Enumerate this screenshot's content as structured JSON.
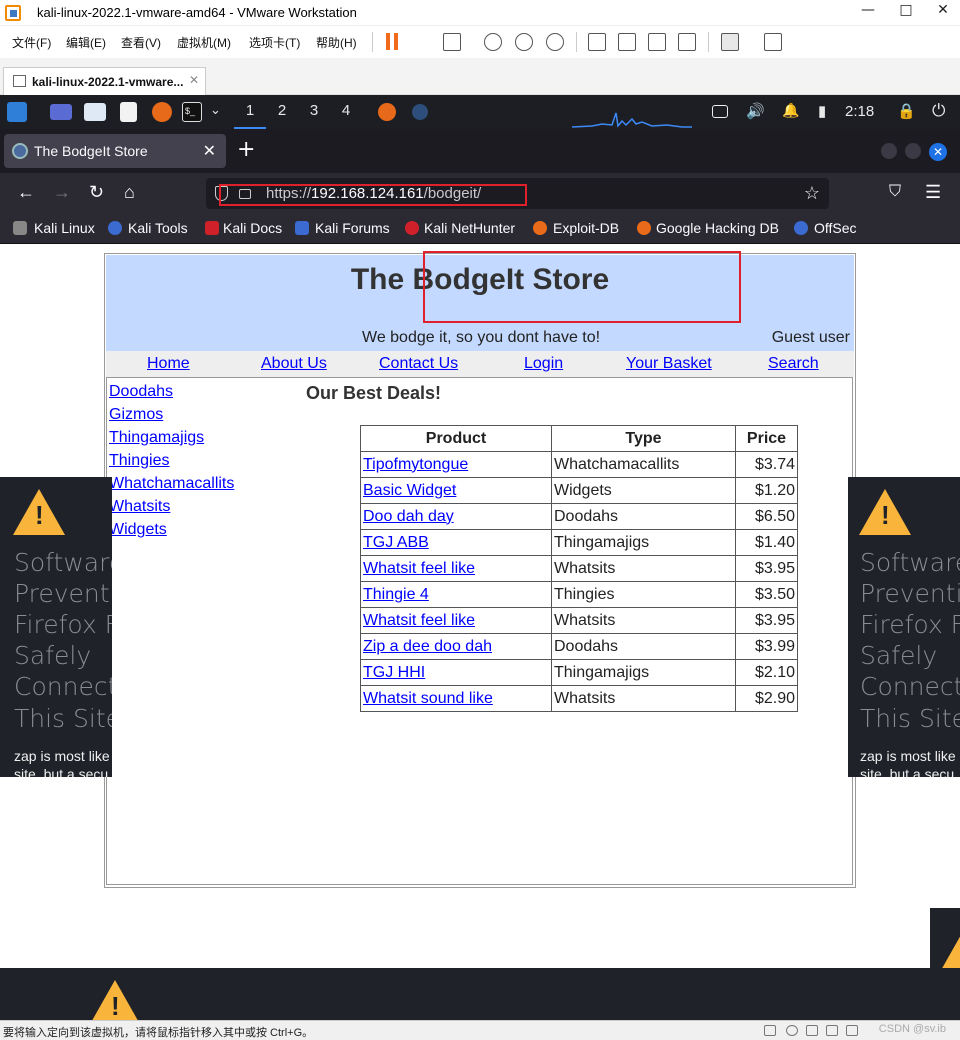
{
  "vmware": {
    "window_title": "kali-linux-2022.1-vmware-amd64 - VMware Workstation",
    "window_controls": {
      "minimize": "—",
      "maximize": "□",
      "close": "✕"
    },
    "menu": [
      "文件(F)",
      "编辑(E)",
      "查看(V)",
      "虚拟机(M)",
      "选项卡(T)",
      "帮助(H)"
    ],
    "tab_label": "kali-linux-2022.1-vmware...",
    "status_text": "要将输入定向到该虚拟机，请将鼠标指针移入其中或按 Ctrl+G。",
    "watermark": "CSDN @sv.ib"
  },
  "kali_panel": {
    "workspaces": [
      "1",
      "2",
      "3",
      "4"
    ],
    "active_workspace": "1",
    "clock": "2:18",
    "toolbar_glyphs": {
      "terminal": "$_",
      "dropdown": "⌄",
      "volume": "🔊",
      "bell": "🔔",
      "battery": "▮",
      "lock": "🔒",
      "power": "⏻"
    }
  },
  "firefox": {
    "tab_title": "The BodgeIt Store",
    "tab_close": "✕",
    "new_tab": "+",
    "close_glyph": "✕",
    "nav_glyphs": {
      "back": "←",
      "forward": "→",
      "reload": "↻",
      "home": "⌂",
      "bookmark": "☆",
      "pocket": "⛉",
      "menu": "☰"
    },
    "url_scheme": "https://",
    "url_host": "192.168.124.161",
    "url_path": "/bodgeit/",
    "bookmarks": [
      "Kali Linux",
      "Kali Tools",
      "Kali Docs",
      "Kali Forums",
      "Kali NetHunter",
      "Exploit-DB",
      "Google Hacking DB",
      "OffSec"
    ]
  },
  "store": {
    "title": "The BodgeIt Store",
    "tagline": "We bodge it, so you dont have to!",
    "user": "Guest user",
    "nav": [
      "Home",
      "About Us",
      "Contact Us",
      "Login",
      "Your Basket",
      "Search"
    ],
    "categories": [
      "Doodahs",
      "Gizmos",
      "Thingamajigs",
      "Thingies",
      "Whatchamacallits",
      "Whatsits",
      "Widgets"
    ],
    "deals_title": "Our Best Deals!",
    "table_headers": [
      "Product",
      "Type",
      "Price"
    ],
    "products": [
      {
        "product": "Tipofmytongue",
        "type": "Whatchamacallits",
        "price": "$3.74"
      },
      {
        "product": "Basic Widget",
        "type": "Widgets",
        "price": "$1.20"
      },
      {
        "product": "Doo dah day",
        "type": "Doodahs",
        "price": "$6.50"
      },
      {
        "product": "TGJ ABB",
        "type": "Thingamajigs",
        "price": "$1.40"
      },
      {
        "product": "Whatsit feel like",
        "type": "Whatsits",
        "price": "$3.95"
      },
      {
        "product": "Thingie 4",
        "type": "Thingies",
        "price": "$3.50"
      },
      {
        "product": "Whatsit feel like",
        "type": "Whatsits",
        "price": "$3.95"
      },
      {
        "product": "Zip a dee doo dah",
        "type": "Doodahs",
        "price": "$3.99"
      },
      {
        "product": "TGJ HHI",
        "type": "Thingamajigs",
        "price": "$2.10"
      },
      {
        "product": "Whatsit sound like",
        "type": "Whatsits",
        "price": "$2.90"
      }
    ]
  },
  "zap_overlay": {
    "warning_glyph": "!",
    "big_lines": [
      "Software",
      "Preventin",
      "Firefox F",
      "Safely",
      "Connecti",
      "This Site"
    ],
    "small_lines": [
      "zap is most like",
      "site, but a secu"
    ]
  },
  "colors": {
    "store_header_bg": "#c3d9ff",
    "link": "#0000ff",
    "highlight_box": "#e0202a",
    "warning": "#f9b43b",
    "kali_panel": "#1c1e24",
    "firefox_toolbar": "#2b2a33"
  }
}
